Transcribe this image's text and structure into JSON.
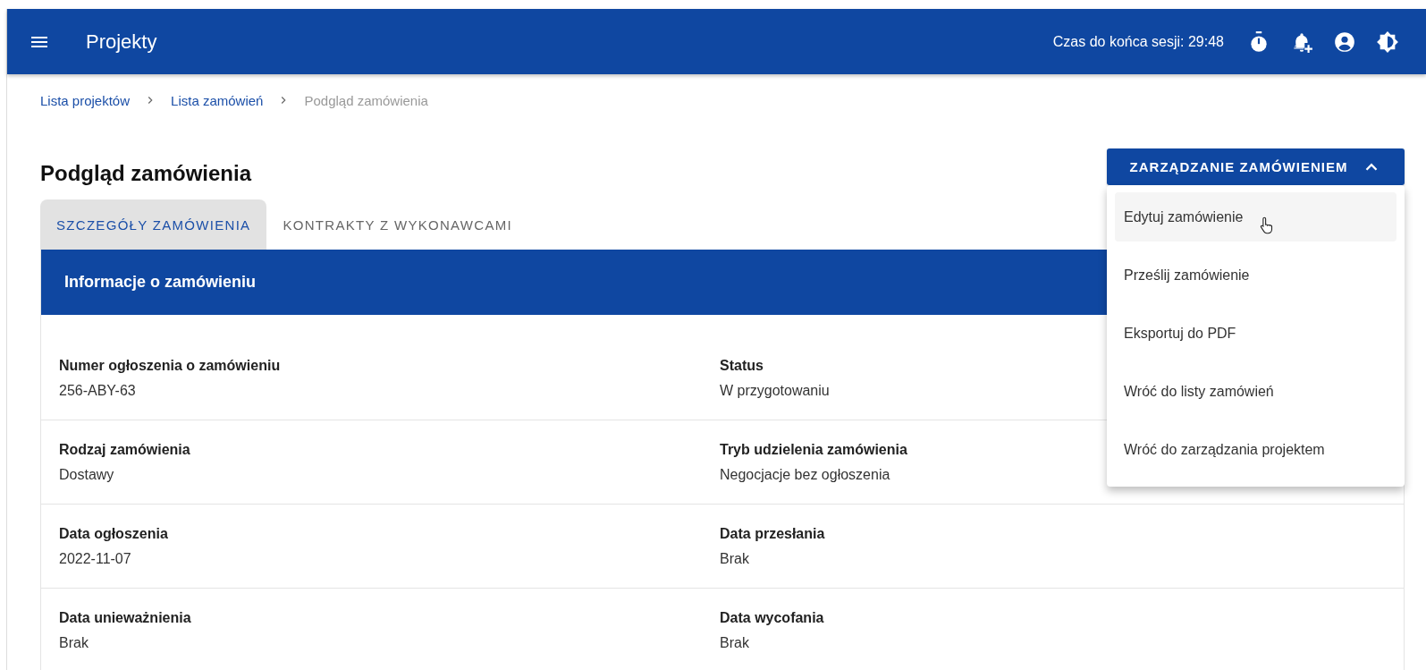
{
  "top_bar": {
    "title": "Projekty",
    "session_label": "Czas do końca sesji: 29:48"
  },
  "breadcrumb": [
    {
      "label": "Lista projektów",
      "current": false
    },
    {
      "label": "Lista zamówień",
      "current": false
    },
    {
      "label": "Podgląd zamówienia",
      "current": true
    }
  ],
  "page_title": "Podgląd zamówienia",
  "manage_button": {
    "label": "ZARZĄDZANIE ZAMÓWIENIEM",
    "expanded": true
  },
  "manage_menu": [
    {
      "label": "Edytuj zamówienie",
      "hovered": true
    },
    {
      "label": "Prześlij zamówienie",
      "hovered": false
    },
    {
      "label": "Eksportuj do PDF",
      "hovered": false
    },
    {
      "label": "Wróć do listy zamówień",
      "hovered": false
    },
    {
      "label": "Wróć do zarządzania projektem",
      "hovered": false
    }
  ],
  "tabs": [
    {
      "label": "SZCZEGÓŁY ZAMÓWIENIA",
      "selected": true
    },
    {
      "label": "KONTRAKTY Z WYKONAWCAMI",
      "selected": false
    }
  ],
  "section": {
    "title": "Informacje o zamówieniu",
    "rows": [
      [
        {
          "label": "Numer ogłoszenia o zamówieniu",
          "value": "256-ABY-63"
        },
        {
          "label": "Status",
          "value": "W przygotowaniu"
        }
      ],
      [
        {
          "label": "Rodzaj zamówienia",
          "value": "Dostawy"
        },
        {
          "label": "Tryb udzielenia zamówienia",
          "value": "Negocjacje bez ogłoszenia"
        }
      ],
      [
        {
          "label": "Data ogłoszenia",
          "value": "2022-11-07"
        },
        {
          "label": "Data przesłania",
          "value": "Brak"
        }
      ],
      [
        {
          "label": "Data unieważnienia",
          "value": "Brak"
        },
        {
          "label": "Data wycofania",
          "value": "Brak"
        }
      ]
    ]
  }
}
